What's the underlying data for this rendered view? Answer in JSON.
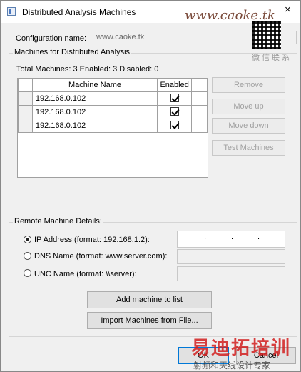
{
  "window": {
    "title": "Distributed Analysis Machines",
    "close_glyph": "×"
  },
  "config": {
    "label": "Configuration name:",
    "value": "www.caoke.tk"
  },
  "machines_group": {
    "label": "Machines for Distributed Analysis",
    "summary": "Total Machines: 3   Enabled: 3   Disabled: 0",
    "columns": [
      "Machine Name",
      "Enabled"
    ],
    "rows": [
      {
        "name": "192.168.0.102",
        "enabled": true
      },
      {
        "name": "192.168.0.102",
        "enabled": true
      },
      {
        "name": "192.168.0.102",
        "enabled": true
      }
    ],
    "buttons": {
      "remove": "Remove",
      "move_up": "Move up",
      "move_down": "Move down",
      "test": "Test Machines"
    }
  },
  "remote_group": {
    "label": "Remote Machine Details:",
    "ip_label": "IP Address (format: 192.168.1.2):",
    "dns_label": "DNS Name (format: www.server.com):",
    "unc_label": "UNC Name (format: \\\\server):",
    "ip_dots": ".",
    "add_button": "Add machine to list",
    "import_button": "Import Machines from File..."
  },
  "footer": {
    "ok": "OK",
    "cancel": "Cancel"
  },
  "watermark": {
    "site": "www.caoke.tk",
    "wechat_label": "微信联系",
    "brand_cn": "易迪拓培训",
    "brand_sub": "射频和天线设计专家"
  },
  "colors": {
    "accent": "#0078d7",
    "watermark_red": "#d21f1f"
  }
}
